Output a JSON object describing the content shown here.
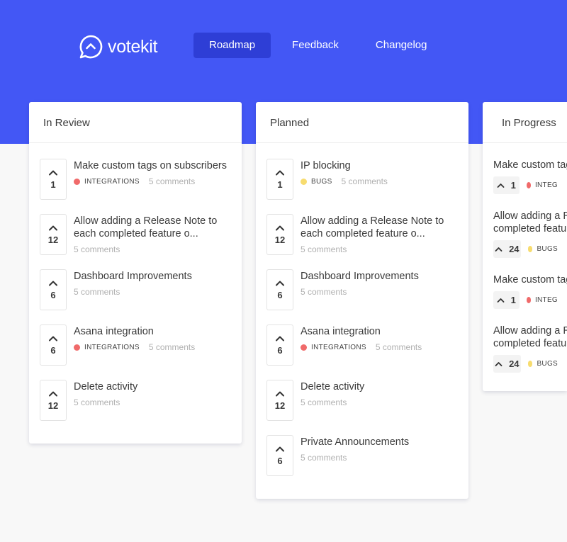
{
  "brand": {
    "name": "votekit"
  },
  "nav": [
    {
      "label": "Roadmap"
    },
    {
      "label": "Feedback"
    },
    {
      "label": "Changelog"
    }
  ],
  "colors": {
    "hero": "#4357f5",
    "integrations": "#f06a6a",
    "bugs": "#f7dc6f"
  },
  "columns": [
    {
      "title": "In Review",
      "items": [
        {
          "votes": "1",
          "title": "Make custom tags on subscribers",
          "tag": "INTEGRATIONS",
          "comments": "5 comments"
        },
        {
          "votes": "12",
          "title": "Allow adding a Release Note to each completed feature o...",
          "comments": "5 comments"
        },
        {
          "votes": "6",
          "title": "Dashboard Improvements",
          "comments": "5 comments"
        },
        {
          "votes": "6",
          "title": "Asana integration",
          "tag": "INTEGRATIONS",
          "comments": "5 comments"
        },
        {
          "votes": "12",
          "title": "Delete activity",
          "comments": "5 comments"
        }
      ]
    },
    {
      "title": "Planned",
      "items": [
        {
          "votes": "1",
          "title": "IP blocking",
          "tag": "BUGS",
          "comments": "5 comments"
        },
        {
          "votes": "12",
          "title": "Allow adding a Release Note to each completed feature o...",
          "comments": "5 comments"
        },
        {
          "votes": "6",
          "title": "Dashboard Improvements",
          "comments": "5 comments"
        },
        {
          "votes": "6",
          "title": "Asana integration",
          "tag": "INTEGRATIONS",
          "comments": "5 comments"
        },
        {
          "votes": "12",
          "title": "Delete activity",
          "comments": "5 comments"
        },
        {
          "votes": "6",
          "title": "Private Announcements",
          "comments": "5 comments"
        }
      ]
    },
    {
      "title": "In Progress",
      "items": [
        {
          "votes": "1",
          "title": "Make custom tags",
          "tag": "INTEG"
        },
        {
          "votes": "24",
          "title": "Allow adding a R completed featu",
          "tag": "BUGS"
        },
        {
          "votes": "1",
          "title": "Make custom tags",
          "tag": "INTEG"
        },
        {
          "votes": "24",
          "title": "Allow adding a R completed featu",
          "tag": "BUGS"
        }
      ]
    }
  ]
}
